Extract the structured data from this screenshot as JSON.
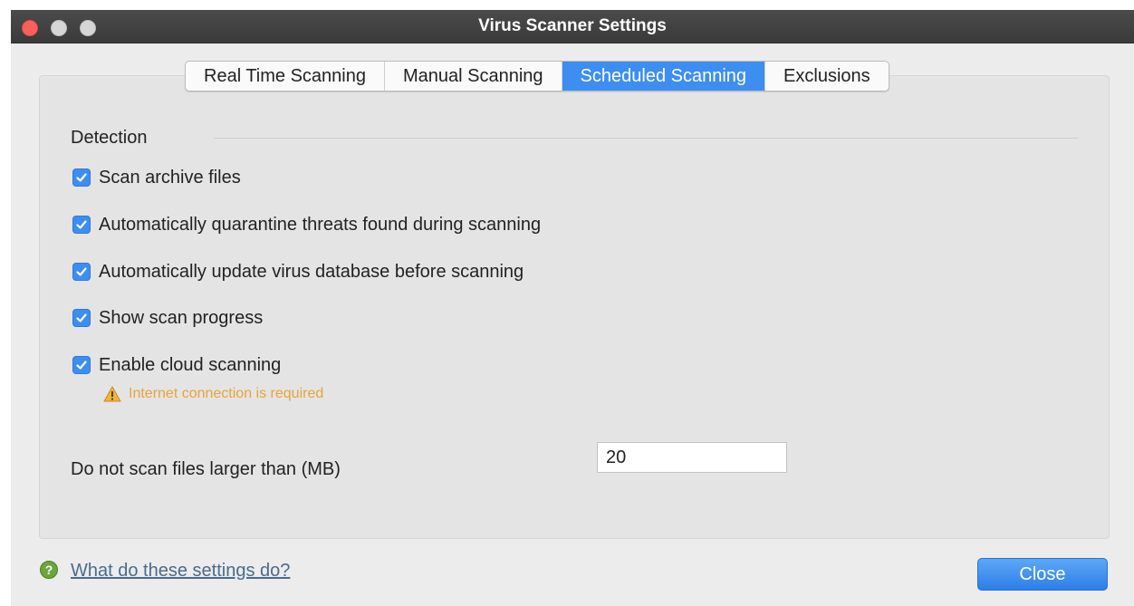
{
  "window": {
    "title": "Virus Scanner Settings"
  },
  "tabs": [
    {
      "label": "Real Time Scanning",
      "active": false
    },
    {
      "label": "Manual Scanning",
      "active": false
    },
    {
      "label": "Scheduled Scanning",
      "active": true
    },
    {
      "label": "Exclusions",
      "active": false
    }
  ],
  "detection": {
    "title": "Detection",
    "options": [
      {
        "label": "Scan archive files",
        "checked": true
      },
      {
        "label": "Automatically quarantine threats found during scanning",
        "checked": true
      },
      {
        "label": "Automatically update virus database before scanning",
        "checked": true
      },
      {
        "label": "Show scan progress",
        "checked": true
      },
      {
        "label": "Enable cloud scanning",
        "checked": true
      }
    ],
    "cloud_note": "Internet connection is required"
  },
  "size_limit": {
    "label": "Do not scan files larger than (MB)",
    "value": "20"
  },
  "footer": {
    "help_link": "What do these settings do?",
    "close_label": "Close"
  },
  "colors": {
    "accent": "#3d8ef0",
    "warning": "#e8a33a",
    "titlebar": "#3f3f3f"
  },
  "icons": [
    "close-window-icon",
    "minimize-window-icon",
    "maximize-window-icon",
    "checkmark-icon",
    "warning-icon",
    "help-icon"
  ]
}
